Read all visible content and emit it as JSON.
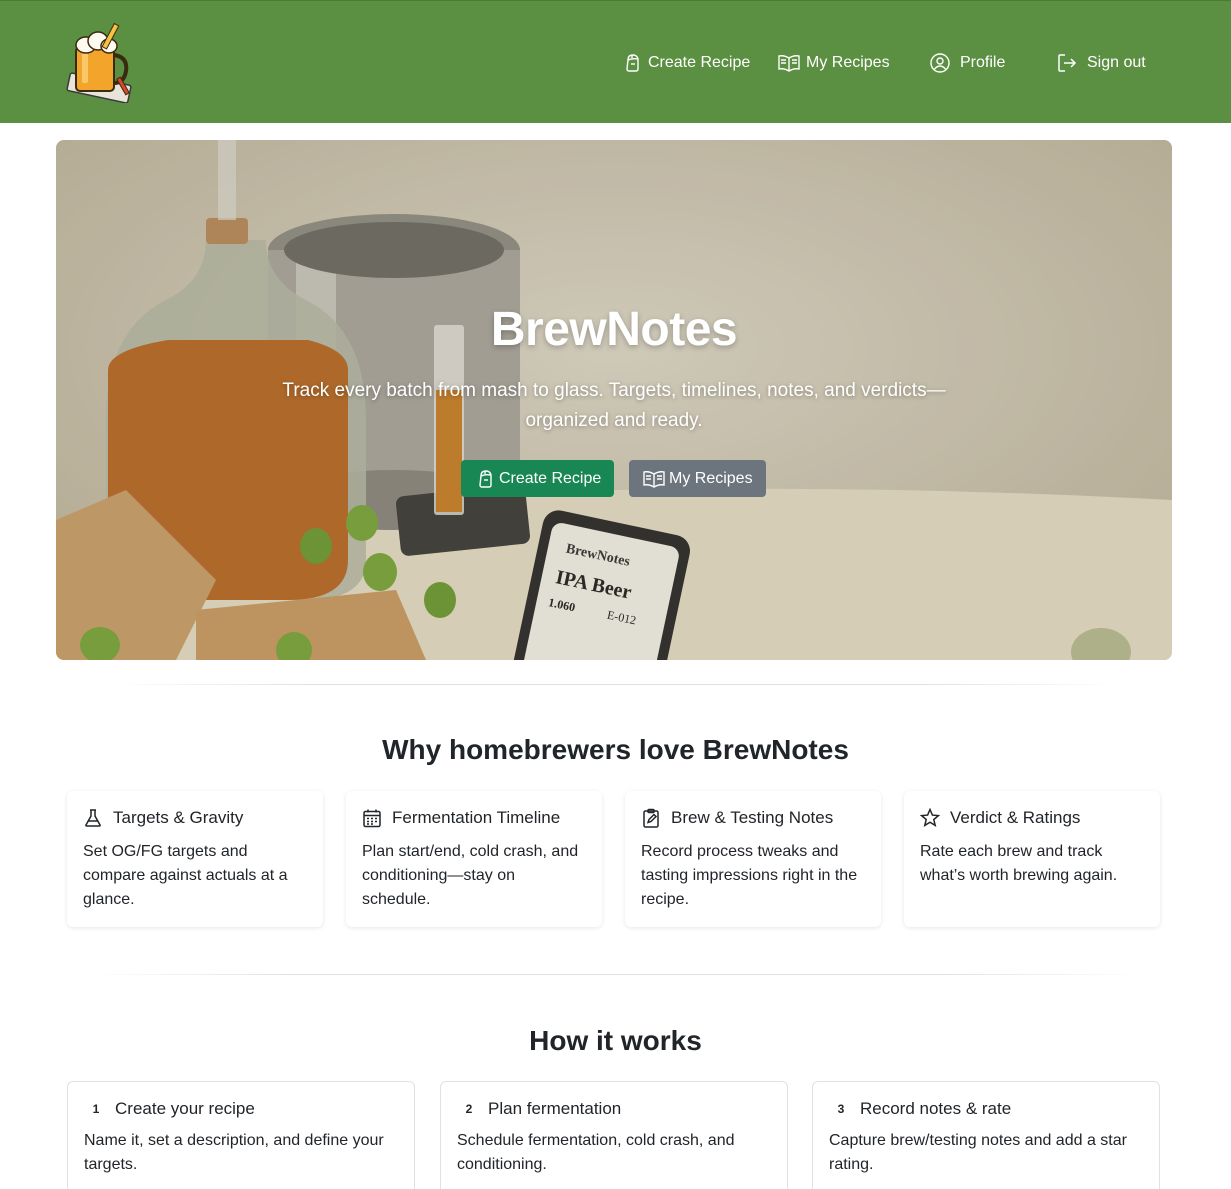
{
  "nav": {
    "logo_alt": "BrewNotes logo",
    "links": [
      {
        "label": "Create Recipe",
        "icon": "hops-icon"
      },
      {
        "label": "My Recipes",
        "icon": "book-icon"
      },
      {
        "label": "Profile",
        "icon": "user-circle-icon"
      },
      {
        "label": "Sign out",
        "icon": "sign-out-icon"
      }
    ]
  },
  "hero": {
    "title": "BrewNotes",
    "subtitle": "Track every batch from mash to glass. Targets, timelines, notes, and verdicts—organized and ready.",
    "buttons": [
      {
        "label": "Create Recipe",
        "color": "#198754"
      },
      {
        "label": "My Recipes",
        "color": "#6c757d"
      }
    ],
    "phone_app_name": "BrewNotes",
    "phone_recipe": "IPA Beer",
    "phone_og": "1.060",
    "phone_fg": "E-012"
  },
  "features": {
    "title": "Why homebrewers love BrewNotes",
    "cards": [
      {
        "title": "Targets & Gravity",
        "text": "Set OG/FG targets and compare against actuals at a glance.",
        "icon": "flask-icon"
      },
      {
        "title": "Fermentation Timeline",
        "text": "Plan start/end, cold crash, and conditioning—stay on schedule.",
        "icon": "calendar-icon"
      },
      {
        "title": "Brew & Testing Notes",
        "text": "Record process tweaks and tasting impressions right in the recipe.",
        "icon": "clipboard-edit-icon"
      },
      {
        "title": "Verdict & Ratings",
        "text": "Rate each brew and track what’s worth brewing again.",
        "icon": "star-icon"
      }
    ]
  },
  "how": {
    "title": "How it works",
    "steps": [
      {
        "num": "1",
        "title": "Create your recipe",
        "text": "Name it, set a description, and define your targets."
      },
      {
        "num": "2",
        "title": "Plan fermentation",
        "text": "Schedule fermentation, cold crash, and conditioning."
      },
      {
        "num": "3",
        "title": "Record notes & rate",
        "text": "Capture brew/testing notes and add a star rating."
      }
    ]
  },
  "colors": {
    "navbar": "#5b8f42",
    "primary_button": "#198754",
    "secondary_button": "#6c757d"
  }
}
